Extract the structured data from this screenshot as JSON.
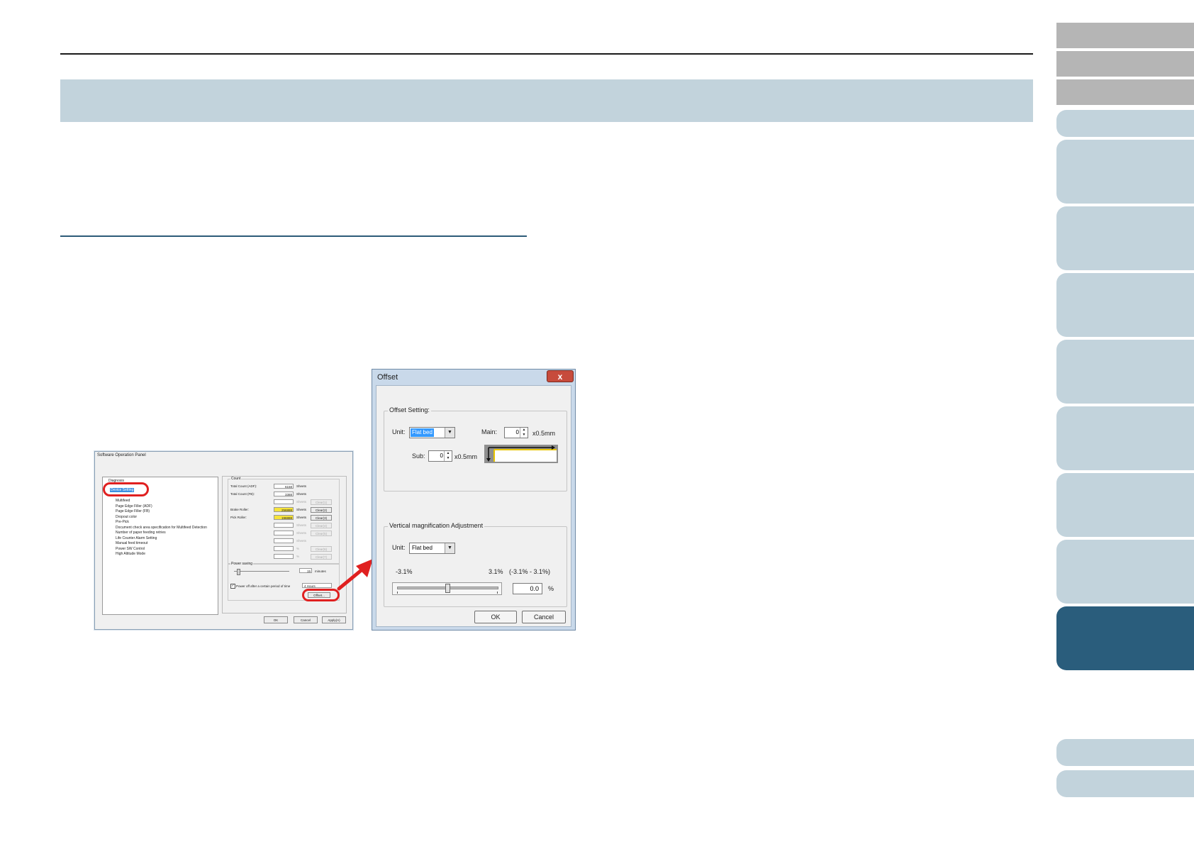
{
  "side_tabs": [
    {
      "label": ""
    },
    {
      "label": ""
    },
    {
      "label": ""
    },
    {
      "label": ""
    },
    {
      "label": ""
    },
    {
      "label": ""
    },
    {
      "label": ""
    },
    {
      "label": ""
    },
    {
      "label": ""
    },
    {
      "label": ""
    },
    {
      "label": ""
    },
    {
      "label": ""
    },
    {
      "label": ""
    },
    {
      "label": ""
    }
  ],
  "colors": {
    "accent": "#2a5d7c",
    "band": "#c2d3dc",
    "highlight_red": "#e02020"
  },
  "sop": {
    "title": "Software Operation Panel",
    "tree": {
      "root": "Diagnosis",
      "selected": "Device Setting",
      "items": [
        "Multifeed",
        "Page Edge Filler (ADF)",
        "Page Edge Filler (FB)",
        "Dropout color",
        "Pre-Pick",
        "Document check area specification for Multifeed Detection",
        "Number of paper feeding retries",
        "Life Counter Alarm Setting",
        "Manual feed timeout",
        "Power SW Control",
        "High Altitude Mode"
      ]
    },
    "count": {
      "label": "Count",
      "total_adf_label": "Total Count (ADF):",
      "total_adf": "6158",
      "total_fb_label": "Total Count (FB):",
      "total_fb": "3388",
      "brake_label": "Brake Roller:",
      "brake": "256888",
      "pick_label": "Pick Roller:",
      "pick": "196888",
      "unit": "Sheets",
      "clear": "Clear(1)",
      "clear_brake": "Clear(2)",
      "clear_pick": "Clear(3)",
      "clear_4": "Clear(4)",
      "clear_5": "Clear(5)",
      "clear_6": "Clear(6)",
      "clear_7": "Clear(7)",
      "clear_8": "Clear(8)",
      "pct": "%"
    },
    "power": {
      "label": "Power saving",
      "minutes_value": "15",
      "minutes_unit": "minutes",
      "power_off_label": "Power off after a certain period of time",
      "hours_value": "4 Hours",
      "offset_button": "Offset..."
    },
    "buttons": {
      "ok": "OK",
      "cancel": "Cancel",
      "apply": "Apply(A)"
    }
  },
  "offset": {
    "title": "Offset",
    "close": "x",
    "offset_setting": {
      "label": "Offset Setting:",
      "unit_label": "Unit:",
      "unit_value": "Flat bed",
      "main_label": "Main:",
      "main_value": "0",
      "main_unit": "x0.5mm",
      "sub_label": "Sub:",
      "sub_value": "0",
      "sub_unit": "x0.5mm"
    },
    "vertical": {
      "label": "Vertical magnification Adjustment",
      "unit_label": "Unit:",
      "unit_value": "Flat bed",
      "min_label": "-3.1%",
      "max_label": "3.1%",
      "range_label": "(-3.1% - 3.1%)",
      "value": "0.0",
      "percent": "%",
      "slider_level": 0.5
    },
    "buttons": {
      "ok": "OK",
      "cancel": "Cancel"
    }
  }
}
